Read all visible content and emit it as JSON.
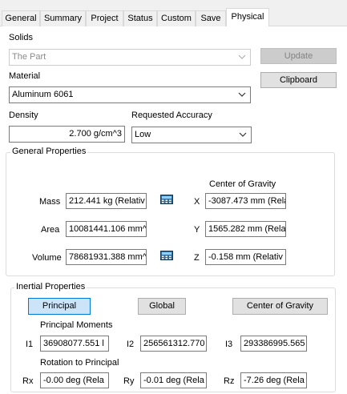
{
  "tabs": [
    {
      "label": "General"
    },
    {
      "label": "Summary"
    },
    {
      "label": "Project"
    },
    {
      "label": "Status"
    },
    {
      "label": "Custom"
    },
    {
      "label": "Save"
    },
    {
      "label": "Physical"
    }
  ],
  "solids": {
    "label": "Solids",
    "value": "The Part",
    "update_button": "Update"
  },
  "material": {
    "label": "Material",
    "value": "Aluminum 6061",
    "clipboard_button": "Clipboard"
  },
  "density": {
    "label": "Density",
    "value": "2.700 g/cm^3"
  },
  "accuracy": {
    "label": "Requested Accuracy",
    "value": "Low"
  },
  "general_properties": {
    "title": "General Properties",
    "cog_header": "Center of Gravity",
    "mass_label": "Mass",
    "mass_value": "212.441 kg (Relativ",
    "area_label": "Area",
    "area_value": "10081441.106 mm^",
    "volume_label": "Volume",
    "volume_value": "78681931.388 mm^",
    "x_label": "X",
    "x_value": "-3087.473 mm (Rela",
    "y_label": "Y",
    "y_value": "1565.282 mm (Rela",
    "z_label": "Z",
    "z_value": "-0.158 mm (Relativ"
  },
  "inertial_properties": {
    "title": "Inertial Properties",
    "principal_button": "Principal",
    "global_button": "Global",
    "cog_button": "Center of Gravity",
    "principal_moments_label": "Principal Moments",
    "i1_label": "I1",
    "i1_value": "36908077.551 l",
    "i2_label": "I2",
    "i2_value": "256561312.770",
    "i3_label": "I3",
    "i3_value": "293386995.565",
    "rotation_label": "Rotation to Principal",
    "rx_label": "Rx",
    "rx_value": "-0.00 deg (Rela",
    "ry_label": "Ry",
    "ry_value": "-0.01 deg (Rela",
    "rz_label": "Rz",
    "rz_value": "-7.26 deg (Rela"
  },
  "icons": {
    "calculator": "calculator-icon",
    "dropdown": "chevron-down-icon"
  }
}
